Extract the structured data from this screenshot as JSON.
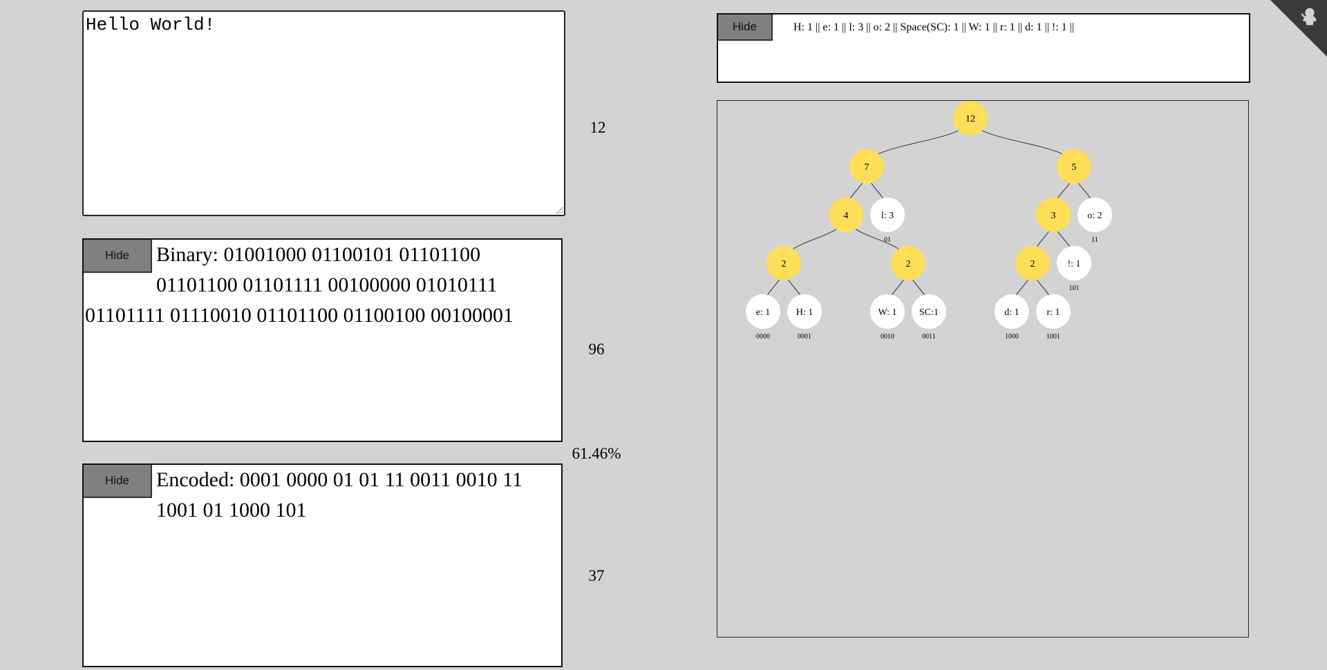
{
  "input": {
    "value": "Hello World!",
    "character_count": "12"
  },
  "binary": {
    "hide_label": "Hide",
    "text": "Binary: 01001000 01100101 01101100 01101100 01101111 00100000 01010111 01101111 01110010 01101100 01100100 00100001",
    "bit_count": "96"
  },
  "compression": {
    "ratio": "61.46%"
  },
  "encoded": {
    "hide_label": "Hide",
    "text": "Encoded: 0001 0000 01 01 11 0011 0010 11 1001 01 1000 101",
    "bit_count": "37"
  },
  "frequency": {
    "hide_label": "Hide",
    "text": "H: 1 || e: 1 || l: 3 || o: 2 || Space(SC): 1 || W: 1 || r: 1 || d: 1 || !: 1 ||"
  },
  "tree": {
    "colors": {
      "internal": "#ffde59",
      "leaf": "#ffffff",
      "edge": "#333333"
    },
    "nodes": [
      {
        "id": "root",
        "label": "12",
        "kind": "internal"
      },
      {
        "id": "n7",
        "label": "7",
        "kind": "internal"
      },
      {
        "id": "n5",
        "label": "5",
        "kind": "internal"
      },
      {
        "id": "n4",
        "label": "4",
        "kind": "internal"
      },
      {
        "id": "l",
        "label": "l: 3",
        "kind": "leaf",
        "code": "01"
      },
      {
        "id": "n3",
        "label": "3",
        "kind": "internal"
      },
      {
        "id": "o",
        "label": "o: 2",
        "kind": "leaf",
        "code": "11"
      },
      {
        "id": "n2a",
        "label": "2",
        "kind": "internal"
      },
      {
        "id": "n2b",
        "label": "2",
        "kind": "internal"
      },
      {
        "id": "n2c",
        "label": "2",
        "kind": "internal"
      },
      {
        "id": "bang",
        "label": "!: 1",
        "kind": "leaf",
        "code": "101"
      },
      {
        "id": "e",
        "label": "e: 1",
        "kind": "leaf",
        "code": "0000"
      },
      {
        "id": "H",
        "label": "H: 1",
        "kind": "leaf",
        "code": "0001"
      },
      {
        "id": "W",
        "label": "W: 1",
        "kind": "leaf",
        "code": "0010"
      },
      {
        "id": "SC",
        "label": "SC:1",
        "kind": "leaf",
        "code": "0011"
      },
      {
        "id": "d",
        "label": "d: 1",
        "kind": "leaf",
        "code": "1000"
      },
      {
        "id": "r",
        "label": "r: 1",
        "kind": "leaf",
        "code": "1001"
      }
    ],
    "edges": [
      [
        "root",
        "n7"
      ],
      [
        "root",
        "n5"
      ],
      [
        "n7",
        "n4"
      ],
      [
        "n7",
        "l"
      ],
      [
        "n5",
        "n3"
      ],
      [
        "n5",
        "o"
      ],
      [
        "n4",
        "n2a"
      ],
      [
        "n4",
        "n2b"
      ],
      [
        "n3",
        "n2c"
      ],
      [
        "n3",
        "bang"
      ],
      [
        "n2a",
        "e"
      ],
      [
        "n2a",
        "H"
      ],
      [
        "n2b",
        "W"
      ],
      [
        "n2b",
        "SC"
      ],
      [
        "n2c",
        "d"
      ],
      [
        "n2c",
        "r"
      ]
    ]
  },
  "corner": {
    "icon": "github-octocat-icon"
  }
}
